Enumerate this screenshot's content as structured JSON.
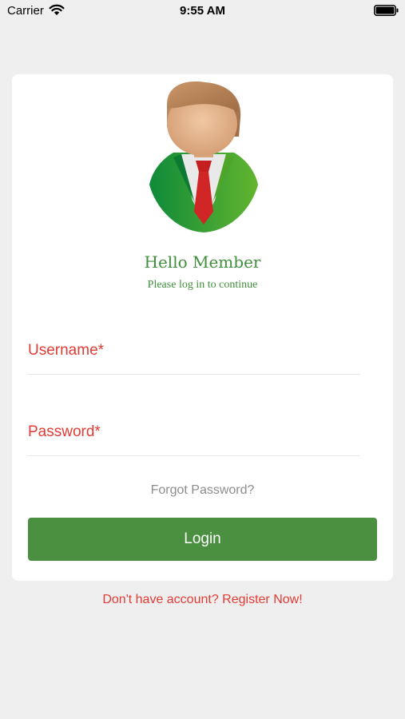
{
  "status_bar": {
    "carrier": "Carrier",
    "time": "9:55 AM"
  },
  "login": {
    "greeting": "Hello Member",
    "subtitle": "Please log in to continue",
    "username_label": "Username*",
    "password_label": "Password*",
    "forgot_password": "Forgot Password?",
    "login_button": "Login"
  },
  "register_link": "Don't have account? Register Now!",
  "colors": {
    "background": "#efefef",
    "card": "#ffffff",
    "accent_green": "#4a9040",
    "label_red": "#e33b35",
    "muted_gray": "#8c8c8c"
  },
  "icons": {
    "avatar": "member-avatar-icon",
    "wifi": "wifi-icon",
    "battery": "battery-icon"
  }
}
